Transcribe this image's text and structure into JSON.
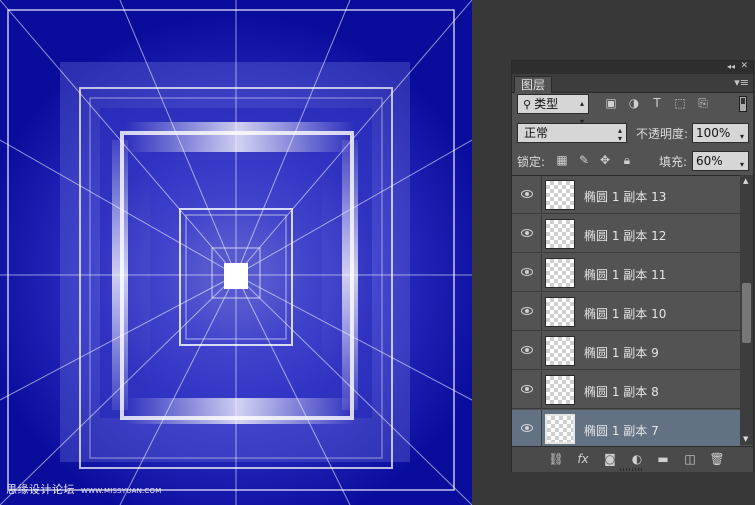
{
  "watermark": {
    "main": "思缘设计论坛",
    "small": "WWW.MISSYUAN.COM"
  },
  "panel": {
    "collapse_glyph": "◂◂",
    "close_glyph": "✕",
    "tab_label": "图层",
    "menu_glyph": "▾≡",
    "filter_kind": "类型",
    "filter_icons": [
      "image-filter-icon",
      "adjustment-filter-icon",
      "text-filter-icon",
      "shape-filter-icon",
      "smart-object-filter-icon"
    ],
    "blend_mode": "正常",
    "opacity_label": "不透明度:",
    "opacity_value": "100%",
    "lock_label": "锁定:",
    "lock_icons": [
      "lock-transparent-icon",
      "lock-image-icon",
      "lock-position-icon",
      "lock-all-icon"
    ],
    "fill_label": "填充:",
    "fill_value": "60%"
  },
  "layers": [
    {
      "name": "椭圆 1 副本 13",
      "visible": true,
      "selected": false
    },
    {
      "name": "椭圆 1 副本 12",
      "visible": true,
      "selected": false
    },
    {
      "name": "椭圆 1 副本 11",
      "visible": true,
      "selected": false
    },
    {
      "name": "椭圆 1 副本 10",
      "visible": true,
      "selected": false
    },
    {
      "name": "椭圆 1 副本 9",
      "visible": true,
      "selected": false
    },
    {
      "name": "椭圆 1 副本 8",
      "visible": true,
      "selected": false
    },
    {
      "name": "椭圆 1 副本 7",
      "visible": true,
      "selected": true
    }
  ],
  "footer_icons": [
    "link-layers-icon",
    "fx-icon",
    "add-mask-icon",
    "new-adjustment-icon",
    "new-group-icon",
    "new-layer-icon",
    "delete-layer-icon"
  ],
  "colors": {
    "canvas_bg": "#0a0d9c",
    "panel_bg": "#535353",
    "selected_row": "#627283",
    "workspace": "#383838"
  }
}
